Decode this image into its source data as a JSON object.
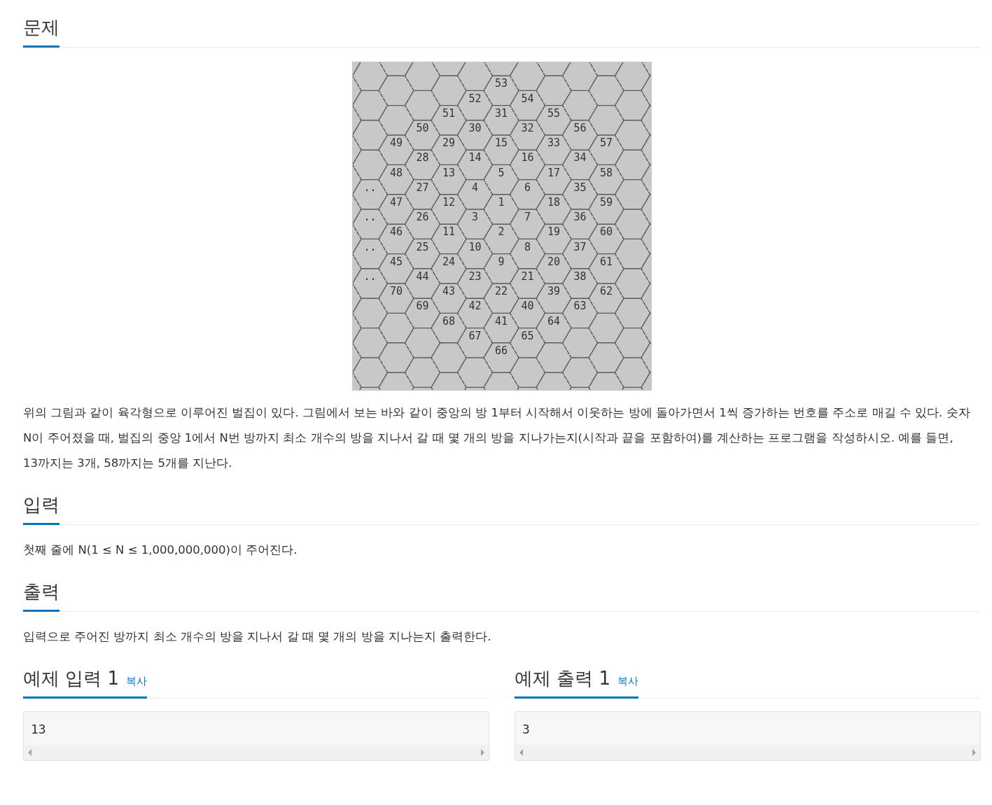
{
  "problem": {
    "title": "문제",
    "diagram": {
      "cell_labels": [
        "53",
        "52",
        "54",
        "51",
        "31",
        "55",
        "50",
        "30",
        "32",
        "56",
        "49",
        "29",
        "15",
        "33",
        "57",
        "28",
        "14",
        "16",
        "34",
        "48",
        "13",
        "5",
        "17",
        "58",
        "..",
        "27",
        "4",
        "6",
        "35",
        "47",
        "12",
        "1",
        "18",
        "59",
        "..",
        "26",
        "3",
        "7",
        "36",
        "46",
        "11",
        "2",
        "19",
        "60",
        "..",
        "25",
        "10",
        "8",
        "37",
        "45",
        "24",
        "9",
        "20",
        "61",
        "..",
        "44",
        "23",
        "21",
        "38",
        "70",
        "43",
        "22",
        "39",
        "62",
        "69",
        "42",
        "40",
        "63",
        "68",
        "41",
        "64",
        "67",
        "65",
        "66"
      ]
    },
    "description": "위의 그림과 같이 육각형으로 이루어진 벌집이 있다. 그림에서 보는 바와 같이 중앙의 방 1부터 시작해서 이웃하는 방에 돌아가면서 1씩 증가하는 번호를 주소로 매길 수 있다. 숫자 N이 주어졌을 때, 벌집의 중앙 1에서 N번 방까지 최소 개수의 방을 지나서 갈 때 몇 개의 방을 지나가는지(시작과 끝을 포함하여)를 계산하는 프로그램을 작성하시오. 예를 들면, 13까지는 3개, 58까지는 5개를 지난다."
  },
  "input": {
    "title": "입력",
    "description": "첫째 줄에 N(1 ≤ N ≤ 1,000,000,000)이 주어진다."
  },
  "output": {
    "title": "출력",
    "description": "입력으로 주어진 방까지 최소 개수의 방을 지나서 갈 때 몇 개의 방을 지나는지 출력한다."
  },
  "samples": [
    {
      "title": "예제 입력 1",
      "copy": "복사",
      "content": "13"
    },
    {
      "title": "예제 출력 1",
      "copy": "복사",
      "content": "3"
    }
  ]
}
